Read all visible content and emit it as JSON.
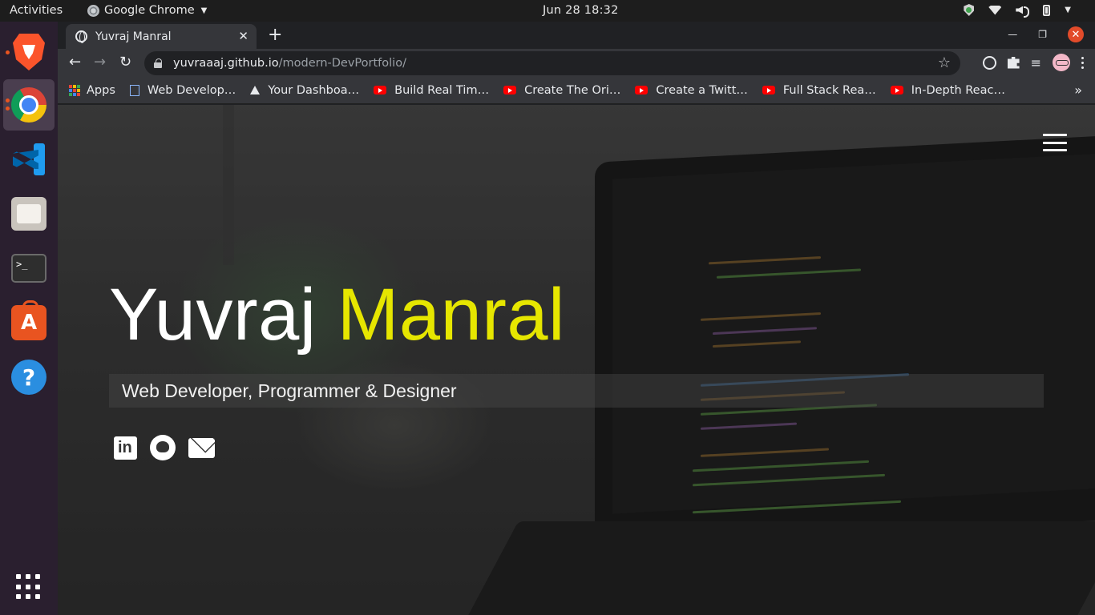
{
  "topbar": {
    "activities": "Activities",
    "app_name": "Google Chrome",
    "clock": "Jun 28  18:32"
  },
  "dock": {
    "items": [
      "brave",
      "chrome",
      "vscode",
      "files",
      "terminal",
      "software",
      "help"
    ]
  },
  "browser": {
    "tab_title": "Yuvraj Manral",
    "url_domain": "yuvraaaj.github.io",
    "url_path": "/modern-DevPortfolio/",
    "bookmarks": [
      {
        "label": "Apps",
        "icon": "apps-grid-icon"
      },
      {
        "label": "Web Develop…",
        "icon": "doc-icon"
      },
      {
        "label": "Your Dashboa…",
        "icon": "triangle-icon"
      },
      {
        "label": "Build Real Tim…",
        "icon": "youtube-icon"
      },
      {
        "label": "Create The Ori…",
        "icon": "youtube-icon"
      },
      {
        "label": "Create a Twitt…",
        "icon": "youtube-icon"
      },
      {
        "label": "Full Stack Rea…",
        "icon": "youtube-icon"
      },
      {
        "label": "In-Depth Reac…",
        "icon": "youtube-icon"
      }
    ]
  },
  "hero": {
    "first_name": "Yuvraj",
    "last_name": "Manral",
    "subtitle": "Web Developer, Programmer & Designer",
    "accent_color": "#e6e600",
    "socials": [
      "linkedin-icon",
      "github-icon",
      "mail-icon"
    ]
  }
}
